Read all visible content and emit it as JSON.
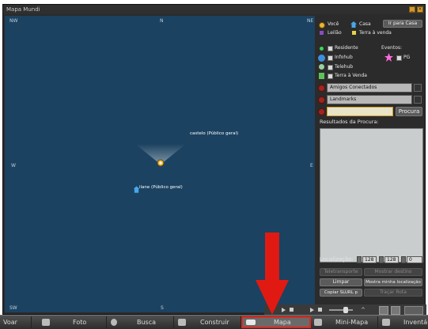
{
  "window": {
    "title": "Mapa Mundi"
  },
  "map": {
    "compass": {
      "nw": "NW",
      "n": "N",
      "ne": "NE",
      "w": "W",
      "e": "E",
      "sw": "SW",
      "s": "S"
    },
    "locations": [
      {
        "label": "castelo (Público geral)"
      },
      {
        "label": "ilane (Público geral)"
      }
    ]
  },
  "legend": {
    "voce": "Você",
    "casa": "Casa",
    "leilao": "Leilão",
    "terra_venda": "Terra à venda",
    "ir_casa_button": "Ir para Casa"
  },
  "filters": {
    "residente": "Residente",
    "infohub": "Infohub",
    "telehub": "Telehub",
    "terra_venda": "Terra à Venda",
    "eventos": "Eventos:",
    "pg": "PG"
  },
  "selectors": {
    "amigos": "Amigos Conectados",
    "landmarks": "Landmarks",
    "search_value": "",
    "procura_button": "Procura"
  },
  "results": {
    "heading": "Resultados da Procura:"
  },
  "location": {
    "label": "Localização:",
    "x": "128",
    "y": "128",
    "z": "0"
  },
  "actions": {
    "teletransporte": "Teletransporte",
    "mostrar_destino": "Mostrar destino",
    "limpar": "Limpar",
    "mostra_minha": "Mostra minha localização",
    "copiar_slurl": "Copiar SLURL p",
    "trace": "Traçar Rota"
  },
  "taskbar": {
    "items": [
      "Voar",
      "Foto",
      "Busca",
      "Construir",
      "Mapa",
      "Mini-Mapa",
      "Inventário"
    ]
  },
  "colors": {
    "map_bg": "#1b4261",
    "highlight": "#e01a12",
    "accent": "#d49a2a"
  }
}
